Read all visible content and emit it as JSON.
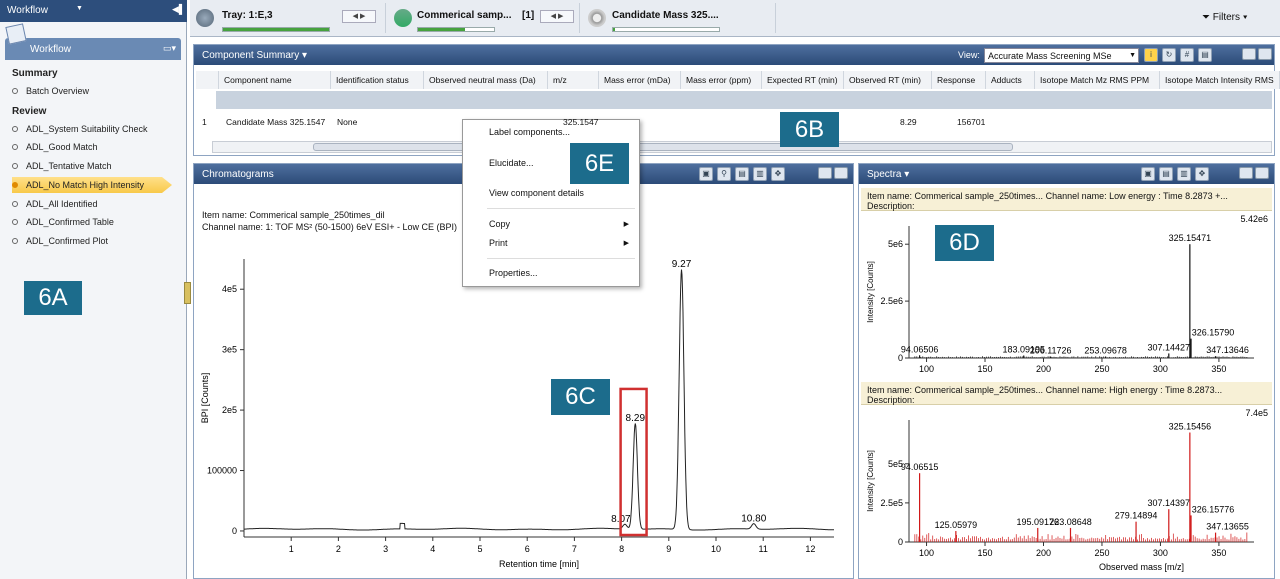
{
  "left_panel": {
    "title": "Workflow",
    "header": "Workflow",
    "sections": [
      {
        "title": "Summary",
        "items": [
          "Batch Overview"
        ]
      },
      {
        "title": "Review",
        "items": [
          "ADL_System Suitability Check",
          "ADL_Good Match",
          "ADL_Tentative Match",
          "ADL_No Match High Intensity",
          "ADL_All Identified",
          "ADL_Confirmed Table",
          "ADL_Confirmed Plot"
        ]
      }
    ],
    "selected_item": "ADL_No Match High Intensity",
    "label_6a": "6A"
  },
  "topbar": {
    "tray": {
      "title": "Tray: 1:E,3",
      "progress": 1.0
    },
    "sample": {
      "title": "Commerical samp...",
      "count": "[1]",
      "progress": 0.62
    },
    "candidate": {
      "title": "Candidate Mass 325....",
      "progress": 0.02
    },
    "filters": "Filters"
  },
  "component_summary": {
    "title": "Component Summary",
    "view_label": "View:",
    "view_value": "Accurate Mass Screening MSe",
    "columns": [
      "Component name",
      "Identification status",
      "Observed neutral mass (Da)",
      "m/z",
      "Mass error (mDa)",
      "Mass error (ppm)",
      "Expected RT (min)",
      "Observed RT (min)",
      "Response",
      "Adducts",
      "Isotope Match Mz RMS PPM",
      "Isotope Match Intensity RMS"
    ],
    "row": {
      "index": "1",
      "name": "Candidate Mass 325.1547",
      "status": "None",
      "mz": "325.1547",
      "observed_rt": "8.29",
      "response": "156701"
    },
    "label_6b": "6B"
  },
  "context_menu": {
    "items": [
      "Label components...",
      "Elucidate...",
      "View component details",
      "Copy",
      "Print",
      "Properties..."
    ],
    "label_6e": "6E"
  },
  "chromatograms": {
    "title": "Chromatograms",
    "item_name": "Item name: Commerical sample_250times_dil",
    "channel_name": "Channel name: 1: TOF MS² (50-1500) 6eV ESI+ - Low CE (BPI)",
    "label_6c": "6C",
    "chart_data": {
      "type": "line",
      "xlabel": "Retention time [min]",
      "ylabel": "BPI [Counts]",
      "xlim": [
        0,
        12.5
      ],
      "ylim": [
        -10000,
        450000
      ],
      "x_ticks": [
        "1",
        "2",
        "3",
        "4",
        "5",
        "6",
        "7",
        "8",
        "9",
        "10",
        "11",
        "12"
      ],
      "y_ticks": [
        "0",
        "100000",
        "2e5",
        "3e5",
        "4e5"
      ],
      "peaks": [
        {
          "rt": 8.07,
          "label": "8.07",
          "height": 8000
        },
        {
          "rt": 8.29,
          "label": "8.29",
          "height": 175000
        },
        {
          "rt": 9.27,
          "label": "9.27",
          "height": 430000
        },
        {
          "rt": 10.8,
          "label": "10.80",
          "height": 9000
        }
      ]
    }
  },
  "spectra": {
    "title": "Spectra",
    "label_6d": "6D",
    "low": {
      "item_name": "Item name: Commerical sample_250times...  Channel name: Low energy : Time 8.2873 +...",
      "description": "Description:",
      "max_label": "5.42e6",
      "chart_data": {
        "type": "bar",
        "ylabel": "Intensity [Counts]",
        "xlim": [
          85,
          380
        ],
        "ylim": [
          0,
          5800000
        ],
        "x_ticks": [
          "100",
          "150",
          "200",
          "250",
          "300",
          "350"
        ],
        "y_ticks": [
          "0",
          "2.5e6",
          "5e6"
        ],
        "labeled_peaks": [
          {
            "mz": 94.06506,
            "label": "94.06506",
            "intensity": 120000
          },
          {
            "mz": 183.09195,
            "label": "183.09195",
            "intensity": 110000
          },
          {
            "mz": 206.11726,
            "label": "206.11726",
            "intensity": 60000
          },
          {
            "mz": 253.09678,
            "label": "253.09678",
            "intensity": 60000
          },
          {
            "mz": 307.14427,
            "label": "307.14427",
            "intensity": 200000
          },
          {
            "mz": 325.15471,
            "label": "325.15471",
            "intensity": 5000000
          },
          {
            "mz": 326.1579,
            "label": "326.15790",
            "intensity": 850000
          },
          {
            "mz": 347.13646,
            "label": "347.13646",
            "intensity": 80000
          }
        ]
      }
    },
    "high": {
      "item_name": "Item name: Commerical sample_250times...  Channel name: High energy : Time 8.2873...",
      "description": "Description:",
      "max_label": "7.4e5",
      "chart_data": {
        "type": "bar",
        "xlabel": "Observed mass [m/z]",
        "ylabel": "Intensity [Counts]",
        "xlim": [
          85,
          380
        ],
        "ylim": [
          0,
          780000
        ],
        "x_ticks": [
          "100",
          "150",
          "200",
          "250",
          "300",
          "350"
        ],
        "y_ticks": [
          "0",
          "2.5e5",
          "5e5"
        ],
        "labeled_peaks": [
          {
            "mz": 94.06515,
            "label": "94.06515",
            "intensity": 440000
          },
          {
            "mz": 125.05979,
            "label": "125.05979",
            "intensity": 70000
          },
          {
            "mz": 195.09176,
            "label": "195.09176",
            "intensity": 90000
          },
          {
            "mz": 223.08648,
            "label": "223.08648",
            "intensity": 90000
          },
          {
            "mz": 279.14894,
            "label": "279.14894",
            "intensity": 130000
          },
          {
            "mz": 307.14397,
            "label": "307.14397",
            "intensity": 210000
          },
          {
            "mz": 325.15456,
            "label": "325.15456",
            "intensity": 700000
          },
          {
            "mz": 326.15776,
            "label": "326.15776",
            "intensity": 170000
          },
          {
            "mz": 347.13655,
            "label": "347.13655",
            "intensity": 60000
          }
        ]
      }
    }
  },
  "colors": {
    "header_blue": "#2c4b78",
    "label_teal": "#1c6c8c",
    "highlight_red": "#d03030",
    "spectrum_red": "#d01818",
    "progress_green": "#46a23e"
  }
}
